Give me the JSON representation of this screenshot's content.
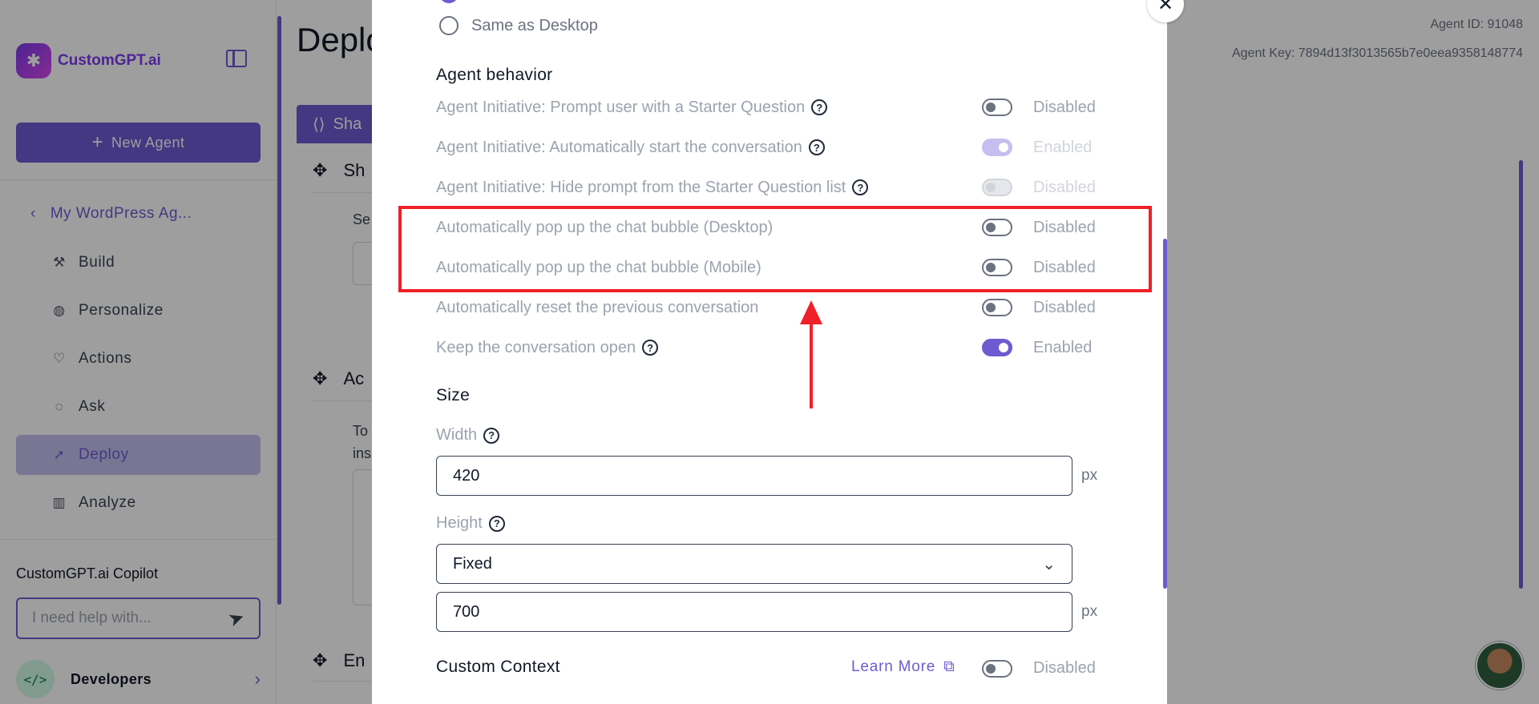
{
  "sidebar": {
    "brand": "CustomGPT.ai",
    "new_agent_label": "New Agent",
    "agent_name": "My WordPress Ag...",
    "nav": [
      {
        "label": "Build",
        "icon": "build-icon"
      },
      {
        "label": "Personalize",
        "icon": "palette-icon"
      },
      {
        "label": "Actions",
        "icon": "actions-icon"
      },
      {
        "label": "Ask",
        "icon": "chat-icon"
      },
      {
        "label": "Deploy",
        "icon": "rocket-icon"
      },
      {
        "label": "Analyze",
        "icon": "chart-icon"
      }
    ],
    "active_item": "Deploy",
    "copilot_title": "CustomGPT.ai Copilot",
    "copilot_placeholder": "I need help with...",
    "developers_label": "Developers"
  },
  "header": {
    "title": "Deplo",
    "agent_id": "Agent ID: 91048",
    "agent_key": "Agent Key: 7894d13f3013565b7e0eea9358148774",
    "share_tab": "Sha"
  },
  "background_sections": [
    {
      "title": "Sh",
      "text": "Se"
    },
    {
      "title": "Ac",
      "text": "To ins"
    },
    {
      "title": "En"
    }
  ],
  "modal": {
    "radio_option": "Same as Desktop",
    "agent_behavior": {
      "title": "Agent behavior",
      "rows": [
        {
          "label": "Agent Initiative: Prompt user with a Starter Question",
          "help": true,
          "status": "Disabled",
          "state": "off"
        },
        {
          "label": "Agent Initiative: Automatically start the conversation",
          "help": true,
          "status": "Enabled",
          "state": "on-faint"
        },
        {
          "label": "Agent Initiative: Hide prompt from the Starter Question list",
          "help": true,
          "status": "Disabled",
          "state": "faint"
        },
        {
          "label": "Automatically pop up the chat bubble (Desktop)",
          "help": false,
          "status": "Disabled",
          "state": "off"
        },
        {
          "label": "Automatically pop up the chat bubble (Mobile)",
          "help": false,
          "status": "Disabled",
          "state": "off"
        },
        {
          "label": "Automatically reset the previous conversation",
          "help": false,
          "status": "Disabled",
          "state": "off"
        },
        {
          "label": "Keep the conversation open",
          "help": true,
          "status": "Enabled",
          "state": "on"
        }
      ]
    },
    "size": {
      "title": "Size",
      "width_label": "Width",
      "width_value": "420",
      "height_label": "Height",
      "height_mode": "Fixed",
      "height_value": "700",
      "unit": "px"
    },
    "custom_context": {
      "title": "Custom Context",
      "learn_more": "Learn More",
      "status": "Disabled"
    }
  },
  "colors": {
    "accent": "#6d5bd0",
    "annotation": "#ef2027"
  }
}
